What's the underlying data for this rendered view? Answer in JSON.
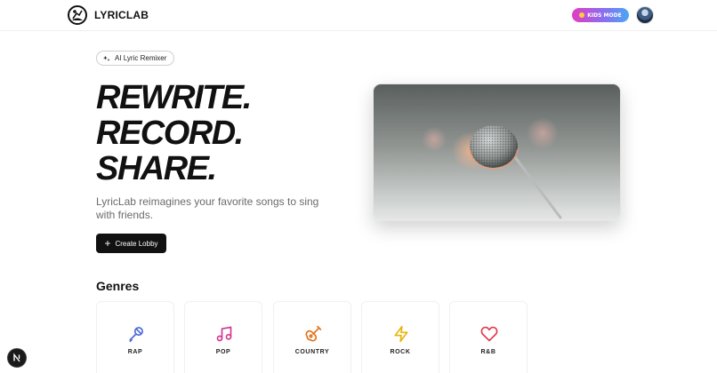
{
  "header": {
    "brand": "LYRICLAB",
    "kids_mode_label": "KIDS MODE"
  },
  "hero": {
    "pill_label": "AI Lyric Remixer",
    "headline": [
      "REWRITE.",
      "RECORD.",
      "SHARE."
    ],
    "subtitle": "LyricLab reimagines your favorite songs to sing with friends.",
    "create_button": "Create Lobby"
  },
  "genres": {
    "title": "Genres",
    "items": [
      {
        "label": "RAP",
        "icon": "microphone-icon",
        "color": "#4a67d6"
      },
      {
        "label": "POP",
        "icon": "music-note-icon",
        "color": "#d6358f"
      },
      {
        "label": "COUNTRY",
        "icon": "guitar-icon",
        "color": "#e0731d"
      },
      {
        "label": "ROCK",
        "icon": "lightning-icon",
        "color": "#e7b40e"
      },
      {
        "label": "R&B",
        "icon": "heart-icon",
        "color": "#e03a4e"
      }
    ]
  },
  "colors": {
    "primary": "#111111",
    "kids_gradient_start": "#e23cc2",
    "kids_gradient_end": "#4aa7f2"
  }
}
